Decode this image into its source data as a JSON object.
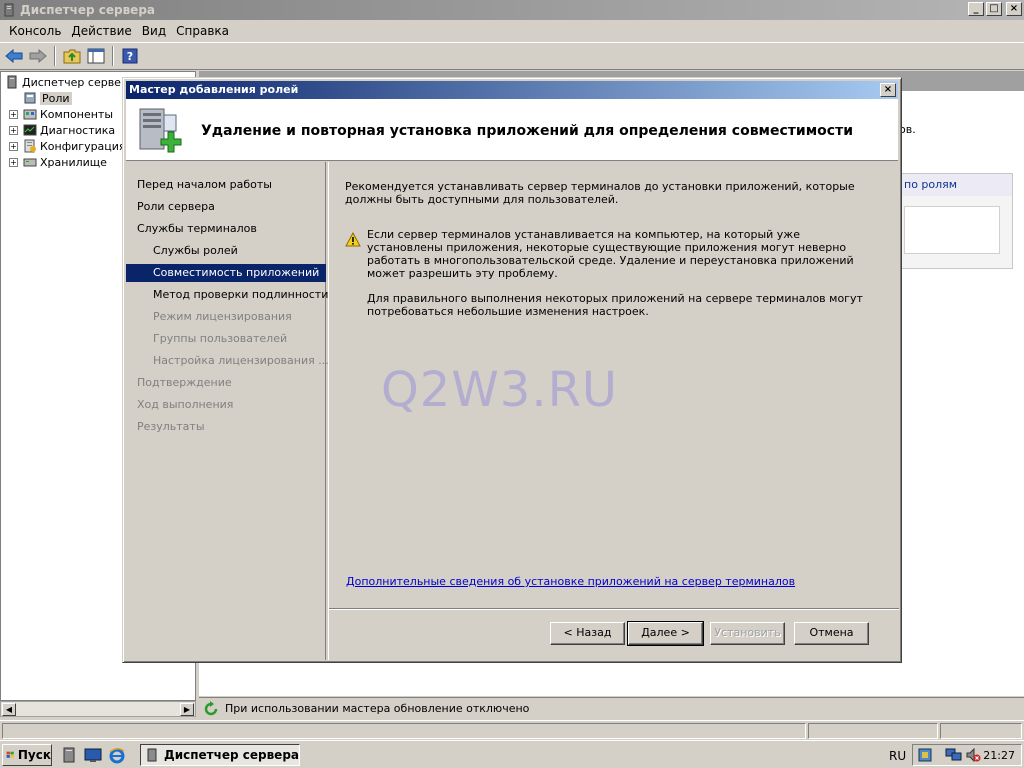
{
  "window": {
    "title": "Диспетчер сервера",
    "buttons": [
      "_",
      "□",
      "×"
    ]
  },
  "menu": [
    "Консоль",
    "Действие",
    "Вид",
    "Справка"
  ],
  "tree": {
    "root": "Диспетчер сервера",
    "items": [
      {
        "label": "Роли",
        "selected": true
      },
      {
        "label": "Компоненты",
        "expander": "+"
      },
      {
        "label": "Диагностика",
        "expander": "+"
      },
      {
        "label": "Конфигурация",
        "expander": "+"
      },
      {
        "label": "Хранилище",
        "expander": "+"
      }
    ]
  },
  "right_pane": {
    "fragment": "ов.",
    "box_header": "по ролям"
  },
  "status_text": "При использовании мастера обновление отключено",
  "dialog": {
    "title": "Мастер добавления ролей",
    "close": "×",
    "header": "Удаление и повторная установка приложений для определения совместимости",
    "steps": [
      {
        "label": "Перед началом работы",
        "state": "normal"
      },
      {
        "label": "Роли сервера",
        "state": "normal"
      },
      {
        "label": "Службы терминалов",
        "state": "normal"
      },
      {
        "label": "Службы ролей",
        "state": "sub"
      },
      {
        "label": "Совместимость приложений",
        "state": "active"
      },
      {
        "label": "Метод проверки подлинности",
        "state": "sub"
      },
      {
        "label": "Режим лицензирования",
        "state": "sub-disabled"
      },
      {
        "label": "Группы пользователей",
        "state": "sub-disabled"
      },
      {
        "label": "Настройка лицензирования ...",
        "state": "sub-disabled"
      },
      {
        "label": "Подтверждение",
        "state": "disabled"
      },
      {
        "label": "Ход выполнения",
        "state": "disabled"
      },
      {
        "label": "Результаты",
        "state": "disabled"
      }
    ],
    "intro": "Рекомендуется устанавливать сервер терминалов до установки приложений, которые должны быть доступными для пользователей.",
    "warning": "Если сервер терминалов устанавливается на компьютер, на который уже установлены приложения, некоторые существующие приложения могут неверно работать в многопользовательской среде. Удаление и переустановка приложений может разрешить эту проблему.",
    "note": "Для правильного выполнения некоторых приложений на сервере терминалов могут потребоваться небольшие изменения настроек.",
    "watermark": "Q2W3.RU",
    "link": "Дополнительные сведения об установке приложений на сервер терминалов",
    "buttons": {
      "back": "< Назад",
      "next": "Далее >",
      "install": "Установить",
      "cancel": "Отмена"
    }
  },
  "taskbar": {
    "start": "Пуск",
    "task": "Диспетчер сервера",
    "lang": "RU",
    "clock": "21:27"
  },
  "colors": {
    "dialog_title": "#0a246a",
    "selection": "#0a246a",
    "link": "#0000cc"
  }
}
